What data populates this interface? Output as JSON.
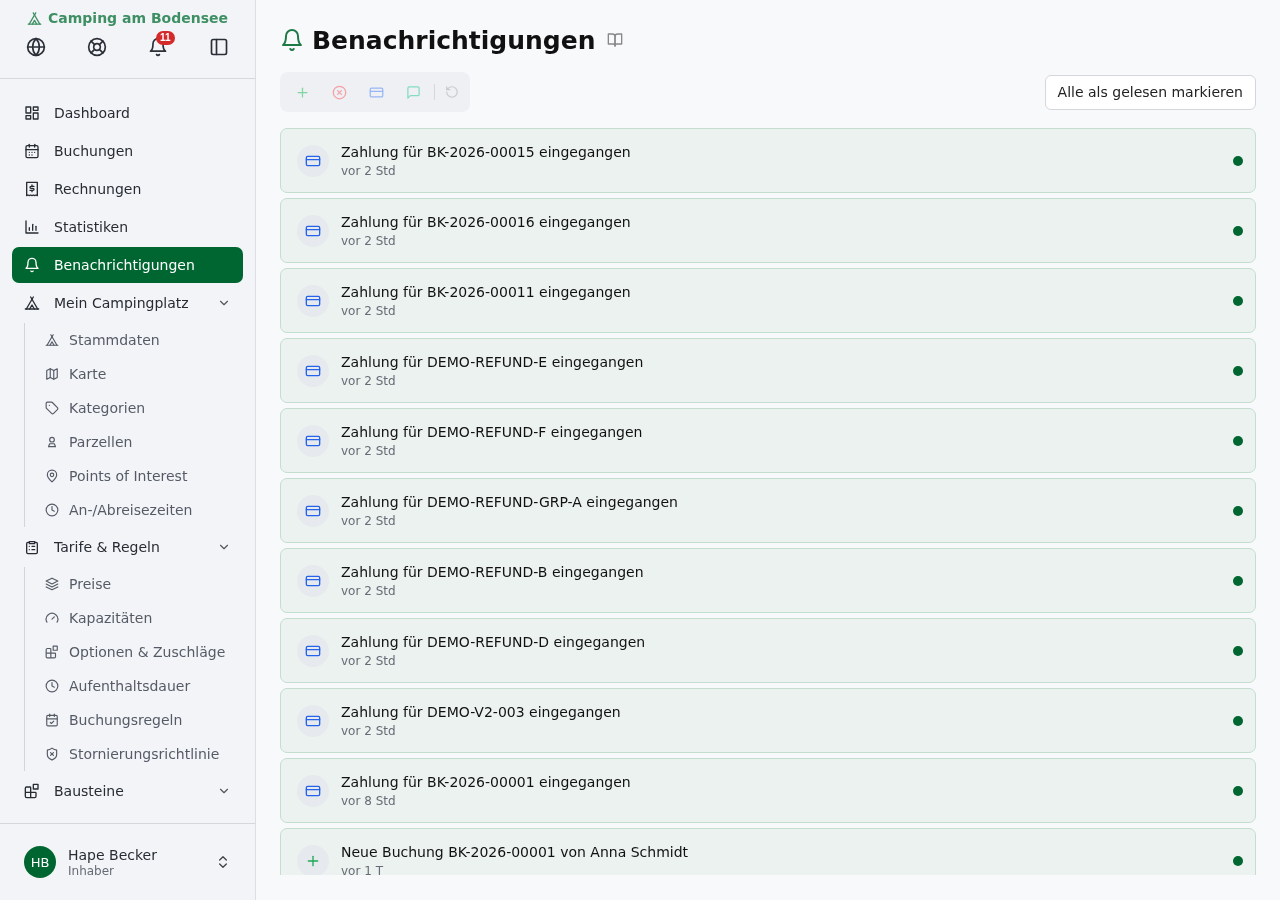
{
  "sidebar": {
    "brand": "Camping am Bodensee",
    "notification_badge": "11",
    "items": [
      {
        "label": "Dashboard",
        "selected": false
      },
      {
        "label": "Buchungen",
        "selected": false
      },
      {
        "label": "Rechnungen",
        "selected": false
      },
      {
        "label": "Statistiken",
        "selected": false
      },
      {
        "label": "Benachrichtigungen",
        "selected": true
      },
      {
        "label": "Mein Campingplatz",
        "selected": false,
        "expanded": true,
        "children": [
          {
            "label": "Stammdaten",
            "selected": false
          },
          {
            "label": "Karte",
            "selected": false
          },
          {
            "label": "Kategorien",
            "selected": false
          },
          {
            "label": "Parzellen",
            "selected": false
          },
          {
            "label": "Points of Interest",
            "selected": false
          },
          {
            "label": "An-/Abreisezeiten",
            "selected": false
          }
        ]
      },
      {
        "label": "Tarife & Regeln",
        "selected": false,
        "expanded": true,
        "children": [
          {
            "label": "Preise",
            "selected": false
          },
          {
            "label": "Kapazitäten",
            "selected": false
          },
          {
            "label": "Optionen & Zuschläge",
            "selected": false
          },
          {
            "label": "Aufenthaltsdauer",
            "selected": false
          },
          {
            "label": "Buchungsregeln",
            "selected": false
          },
          {
            "label": "Stornierungsrichtlinie",
            "selected": false
          }
        ]
      },
      {
        "label": "Bausteine",
        "selected": false,
        "expanded": true
      }
    ],
    "user": {
      "initials": "HB",
      "name": "Hape Becker",
      "role": "Inhaber"
    }
  },
  "page": {
    "title": "Benachrichtigungen",
    "mark_all_button": "Alle als gelesen markieren"
  },
  "notifications": [
    {
      "kind": "payment",
      "title": "Zahlung für BK-2026-00015 eingegangen",
      "time": "vor 2 Std",
      "unread": true
    },
    {
      "kind": "payment",
      "title": "Zahlung für BK-2026-00016 eingegangen",
      "time": "vor 2 Std",
      "unread": true
    },
    {
      "kind": "payment",
      "title": "Zahlung für BK-2026-00011 eingegangen",
      "time": "vor 2 Std",
      "unread": true
    },
    {
      "kind": "payment",
      "title": "Zahlung für DEMO-REFUND-E eingegangen",
      "time": "vor 2 Std",
      "unread": true
    },
    {
      "kind": "payment",
      "title": "Zahlung für DEMO-REFUND-F eingegangen",
      "time": "vor 2 Std",
      "unread": true
    },
    {
      "kind": "payment",
      "title": "Zahlung für DEMO-REFUND-GRP-A eingegangen",
      "time": "vor 2 Std",
      "unread": true
    },
    {
      "kind": "payment",
      "title": "Zahlung für DEMO-REFUND-B eingegangen",
      "time": "vor 2 Std",
      "unread": true
    },
    {
      "kind": "payment",
      "title": "Zahlung für DEMO-REFUND-D eingegangen",
      "time": "vor 2 Std",
      "unread": true
    },
    {
      "kind": "payment",
      "title": "Zahlung für DEMO-V2-003 eingegangen",
      "time": "vor 2 Std",
      "unread": true
    },
    {
      "kind": "payment",
      "title": "Zahlung für BK-2026-00001 eingegangen",
      "time": "vor 8 Std",
      "unread": true
    },
    {
      "kind": "booking",
      "title": "Neue Buchung BK-2026-00001 von Anna Schmidt",
      "time": "vor 1 T",
      "unread": true
    }
  ]
}
